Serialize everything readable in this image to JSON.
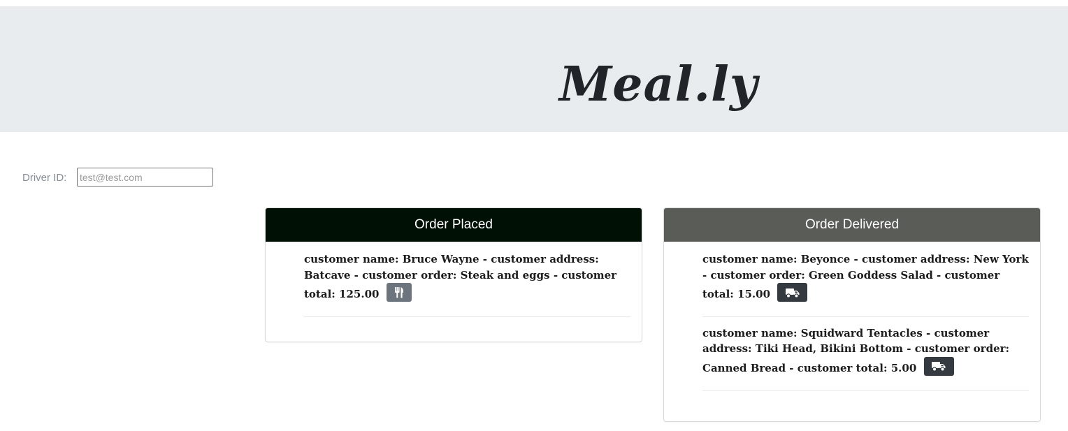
{
  "header": {
    "brand": "Meal.ly"
  },
  "driver": {
    "label": "Driver ID:",
    "placeholder": "test@test.com"
  },
  "placed": {
    "title": "Order Placed",
    "orders": [
      {
        "text": "customer name: Bruce Wayne - customer address: Batcave - customer order: Steak and eggs - customer total: 125.00",
        "button_icon": "utensils-icon"
      }
    ]
  },
  "delivered": {
    "title": "Order Delivered",
    "orders": [
      {
        "text": "customer name: Beyonce - customer address: New York - customer order: Green Goddess Salad - customer total: 15.00",
        "button_icon": "truck-icon"
      },
      {
        "text": "customer name: Squidward Tentacles - customer address: Tiki Head, Bikini Bottom - customer order: Canned Bread - customer total: 5.00",
        "button_icon": "truck-icon"
      }
    ]
  },
  "colors": {
    "jumbotron_bg": "#e9ecef",
    "placed_header_bg": "#001005",
    "delivered_header_bg": "#5a5c58",
    "cook_button": "#6c757d",
    "deliver_button": "#343a40"
  }
}
